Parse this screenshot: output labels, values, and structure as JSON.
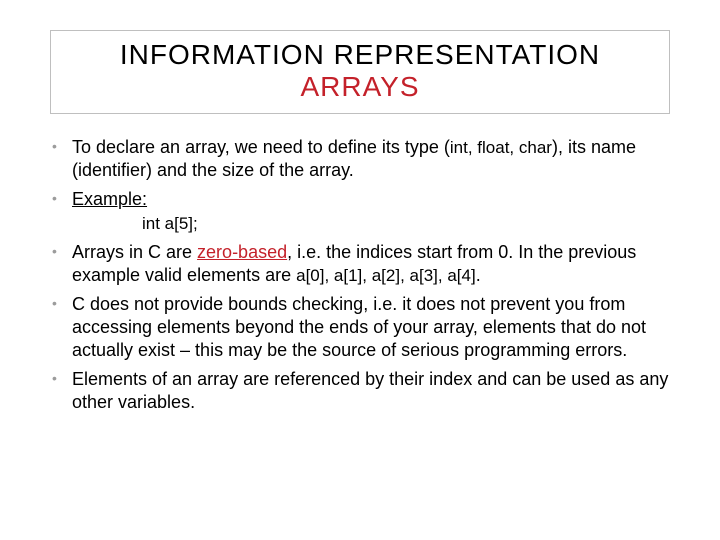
{
  "title": {
    "line1": "INFORMATION REPRESENTATION",
    "line2": "ARRAYS"
  },
  "bullets": {
    "b1a": "To declare an array, we need to define its type (",
    "b1b": "int, float, char",
    "b1c": "), its name (identifier) and the size of the array.",
    "b2": "Example:",
    "b2code": "int a[5];",
    "b3a": "Arrays in C are ",
    "b3b": "zero-based",
    "b3c": ", i.e. the indices start from 0. In the previous example valid elements are ",
    "b3d": "a[0], a[1], a[2], a[3], a[4]",
    "b3e": ".",
    "b4": "C does not provide bounds checking, i.e. it does not prevent you from accessing elements beyond the ends of your array, elements that do not actually exist – this may be the source of serious programming errors.",
    "b5": "Elements of an array are referenced by their index and can be used as any other variables."
  }
}
